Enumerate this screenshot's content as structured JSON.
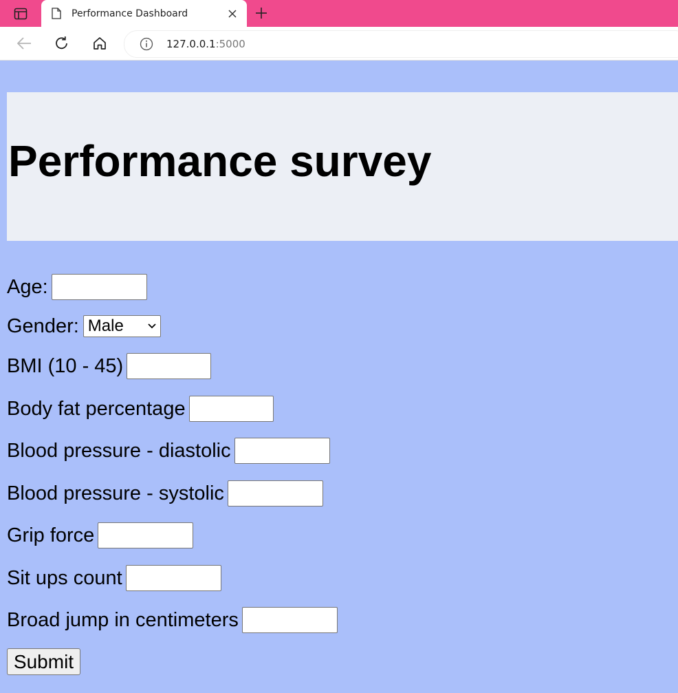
{
  "browser": {
    "tab_title": "Performance Dashboard",
    "url_host": "127.0.0.1",
    "url_port": ":5000",
    "chrome_color": "#f04a8d"
  },
  "page": {
    "title": "Performance survey",
    "background_color": "#aabffa",
    "header_band_color": "#eceff5"
  },
  "form": {
    "age_label": "Age:",
    "age_value": "",
    "gender_label": "Gender:",
    "gender_selected": "Male",
    "bmi_label": "BMI (10 - 45)",
    "bmi_value": "",
    "body_fat_label": "Body fat percentage",
    "body_fat_value": "",
    "bp_diastolic_label": "Blood pressure - diastolic",
    "bp_diastolic_value": "",
    "bp_systolic_label": "Blood pressure - systolic",
    "bp_systolic_value": "",
    "grip_force_label": "Grip force",
    "grip_force_value": "",
    "sit_ups_label": "Sit ups count",
    "sit_ups_value": "",
    "broad_jump_label": "Broad jump in centimeters",
    "broad_jump_value": "",
    "submit_label": "Submit"
  },
  "icons": {
    "sidebar": "sidebar-toggle-icon",
    "tab": "file-icon",
    "close": "close-icon",
    "new_tab": "plus-icon",
    "back": "back-arrow-icon",
    "reload": "reload-icon",
    "home": "home-icon",
    "info": "info-icon",
    "select": "chevron-down-icon"
  }
}
